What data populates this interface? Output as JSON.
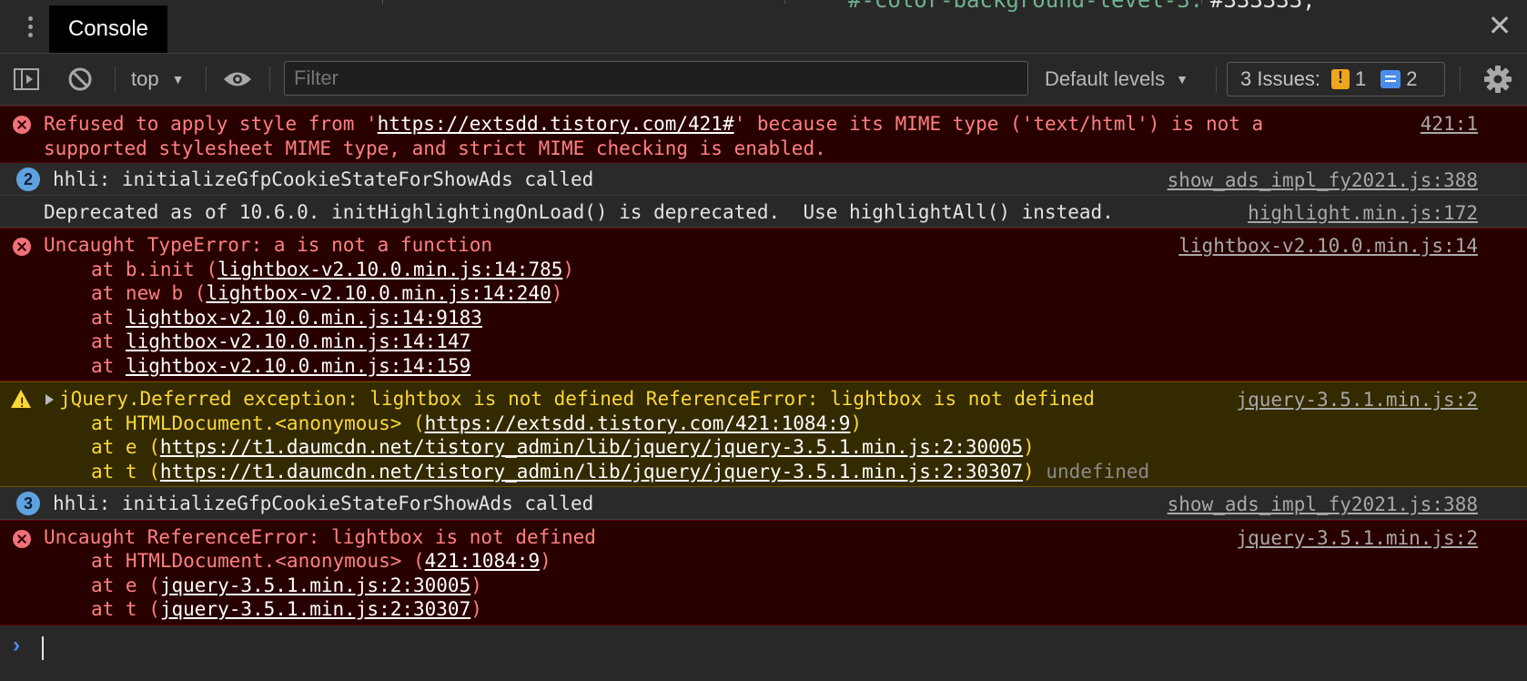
{
  "panel": {
    "tab_label": "Console",
    "bg_snippet_1": "#-color-background-level-3:",
    "bg_snippet_2": "#333333;"
  },
  "toolbar": {
    "context": "top",
    "filter_placeholder": "Filter",
    "levels": "Default levels",
    "issues_label": "3 Issues:",
    "issues_warn_count": "1",
    "issues_info_count": "2"
  },
  "messages": [
    {
      "type": "error",
      "lines": [
        "Refused to apply style from '",
        "https://extsdd.tistory.com/421#",
        "' because its MIME type ('text/html') is not a",
        "supported stylesheet MIME type, and strict MIME checking is enabled."
      ],
      "source": "421:1"
    },
    {
      "type": "info",
      "count": "2",
      "text": "hhli: initializeGfpCookieStateForShowAds called",
      "source": "show_ads_impl_fy2021.js:388"
    },
    {
      "type": "info",
      "text": "Deprecated as of 10.6.0. initHighlightingOnLoad() is deprecated.  Use highlightAll() instead.",
      "source": "highlight.min.js:172"
    },
    {
      "type": "error",
      "text": "Uncaught TypeError: a is not a function",
      "source": "lightbox-v2.10.0.min.js:14",
      "trace": [
        {
          "pre": "at b.init (",
          "link": "lightbox-v2.10.0.min.js:14:785",
          "post": ")"
        },
        {
          "pre": "at new b (",
          "link": "lightbox-v2.10.0.min.js:14:240",
          "post": ")"
        },
        {
          "pre": "at ",
          "link": "lightbox-v2.10.0.min.js:14:9183",
          "post": ""
        },
        {
          "pre": "at ",
          "link": "lightbox-v2.10.0.min.js:14:147",
          "post": ""
        },
        {
          "pre": "at ",
          "link": "lightbox-v2.10.0.min.js:14:159",
          "post": ""
        }
      ]
    },
    {
      "type": "warn",
      "text": "jQuery.Deferred exception: lightbox is not defined ReferenceError: lightbox is not defined",
      "source": "jquery-3.5.1.min.js:2",
      "trace": [
        {
          "pre": "at HTMLDocument.<anonymous> (",
          "link": "https://extsdd.tistory.com/421:1084:9",
          "post": ")"
        },
        {
          "pre": "at e (",
          "link": "https://t1.daumcdn.net/tistory_admin/lib/jquery/jquery-3.5.1.min.js:2:30005",
          "post": ")"
        },
        {
          "pre": "at t (",
          "link": "https://t1.daumcdn.net/tistory_admin/lib/jquery/jquery-3.5.1.min.js:2:30307",
          "post": ") ",
          "extra": "undefined"
        }
      ]
    },
    {
      "type": "info",
      "count": "3",
      "text": "hhli: initializeGfpCookieStateForShowAds called",
      "source": "show_ads_impl_fy2021.js:388"
    },
    {
      "type": "error",
      "text": "Uncaught ReferenceError: lightbox is not defined",
      "source": "jquery-3.5.1.min.js:2",
      "trace": [
        {
          "pre": "at HTMLDocument.<anonymous> (",
          "link": "421:1084:9",
          "post": ")"
        },
        {
          "pre": "at e (",
          "link": "jquery-3.5.1.min.js:2:30005",
          "post": ")"
        },
        {
          "pre": "at t (",
          "link": "jquery-3.5.1.min.js:2:30307",
          "post": ")"
        }
      ]
    }
  ]
}
